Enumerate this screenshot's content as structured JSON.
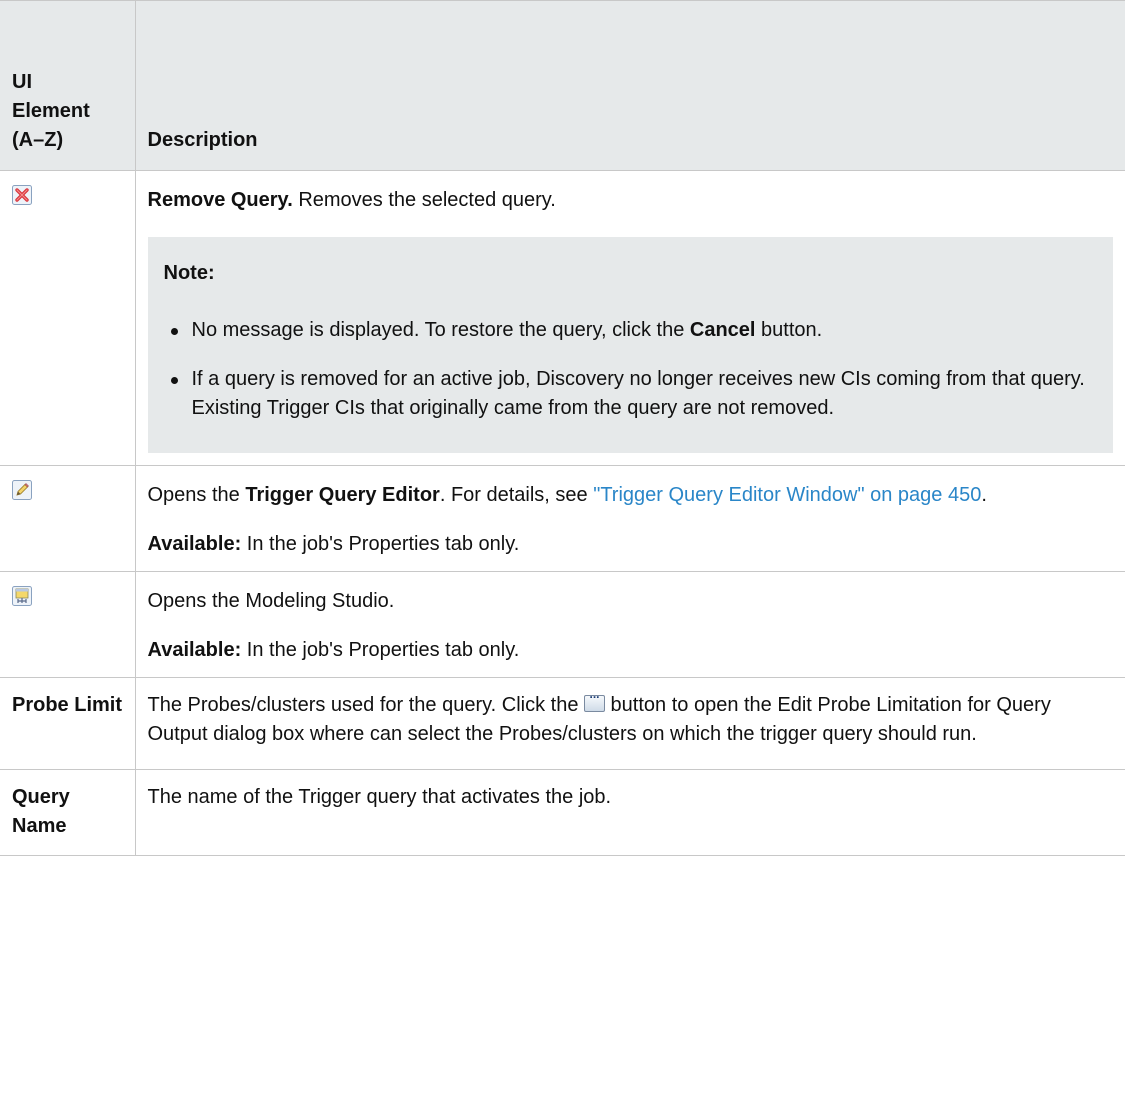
{
  "header": {
    "col1": "UI\nElement\n(A–Z)",
    "col2": "Description"
  },
  "rows": [
    {
      "icon": "remove-query-icon",
      "title": "Remove Query.",
      "text": "Removes the selected query.",
      "note": {
        "title": "Note:",
        "items": [
          {
            "before": "No message is displayed. To restore the query, click the ",
            "bold": "Cancel",
            "after": " button."
          },
          {
            "text": "If a query is removed for an active job, Discovery no longer receives new CIs coming from that query. Existing Trigger CIs that originally came from the query are not removed."
          }
        ]
      }
    },
    {
      "icon": "edit-pencil-icon",
      "before": "Opens the ",
      "bold": "Trigger Query Editor",
      "mid": ". For details, see ",
      "link": "\"Trigger Query Editor Window\" on page 450",
      "after": ".",
      "available_label": "Available:",
      "available_text": " In the job's Properties tab only."
    },
    {
      "icon": "modeling-studio-icon",
      "text": "Opens the Modeling Studio.",
      "available_label": "Available:",
      "available_text": " In the job's Properties tab only."
    },
    {
      "element": "Probe Limit",
      "before": "The Probes/clusters used for the query. Click the ",
      "button_icon": "ellipsis-button-icon",
      "after": " button to open the Edit Probe Limitation for Query Output dialog box where can select the Probes/clusters on which the trigger query should run."
    },
    {
      "element": "Query Name",
      "text": "The name of the Trigger query that activates the job."
    }
  ],
  "colors": {
    "header_bg": "#e6e9ea",
    "border": "#c8c8c8",
    "link": "#2a86c8"
  }
}
